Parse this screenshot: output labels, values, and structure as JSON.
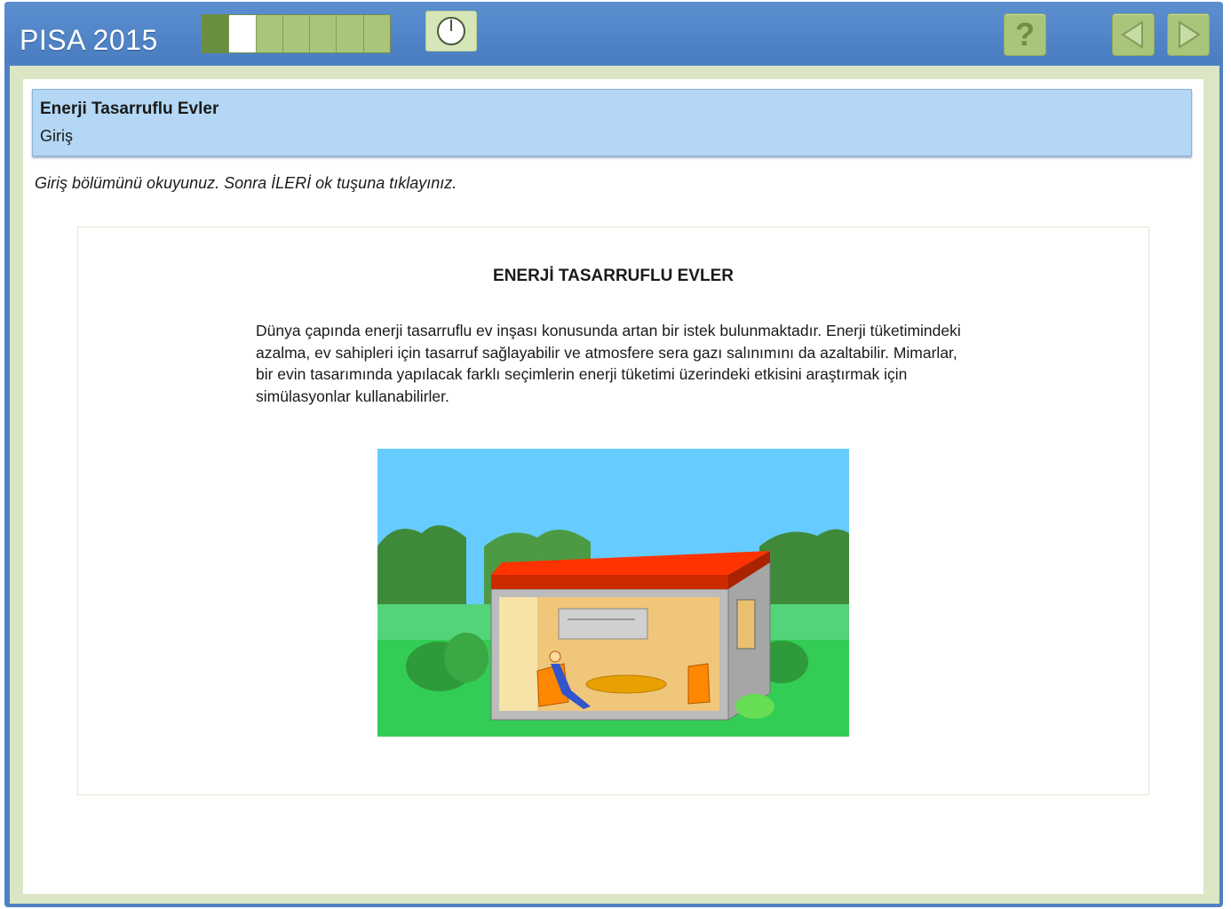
{
  "app": {
    "title": "PISA 2015"
  },
  "progress": {
    "total_segments": 7,
    "completed": 1,
    "current_index": 1
  },
  "icons": {
    "timer": "clock-icon",
    "help": "help-icon",
    "back": "arrow-left-icon",
    "next": "arrow-right-icon"
  },
  "help_label": "?",
  "header": {
    "unit_title": "Enerji Tasarruflu Evler",
    "section": "Giriş"
  },
  "instruction": "Giriş bölümünü okuyunuz. Sonra İLERİ ok tuşuna tıklayınız.",
  "stimulus": {
    "title": "ENERJİ TASARRUFLU EVLER",
    "body": "Dünya çapında enerji tasarruflu ev inşası konusunda artan bir istek bulunmaktadır. Enerji tüketimindeki azalma, ev sahipleri için tasarruf sağlayabilir ve atmosfere sera gazı salınımını da azaltabilir. Mimarlar, bir evin tasarımında yapılacak farklı seçimlerin enerji tüketimi üzerindeki etkisini araştırmak için simülasyonlar kullanabilirler."
  },
  "colors": {
    "topbar": "#4f82c4",
    "button": "#a9c57b",
    "header_box": "#b3d7f4",
    "roof": "#ff3300",
    "sky": "#66ccff"
  }
}
